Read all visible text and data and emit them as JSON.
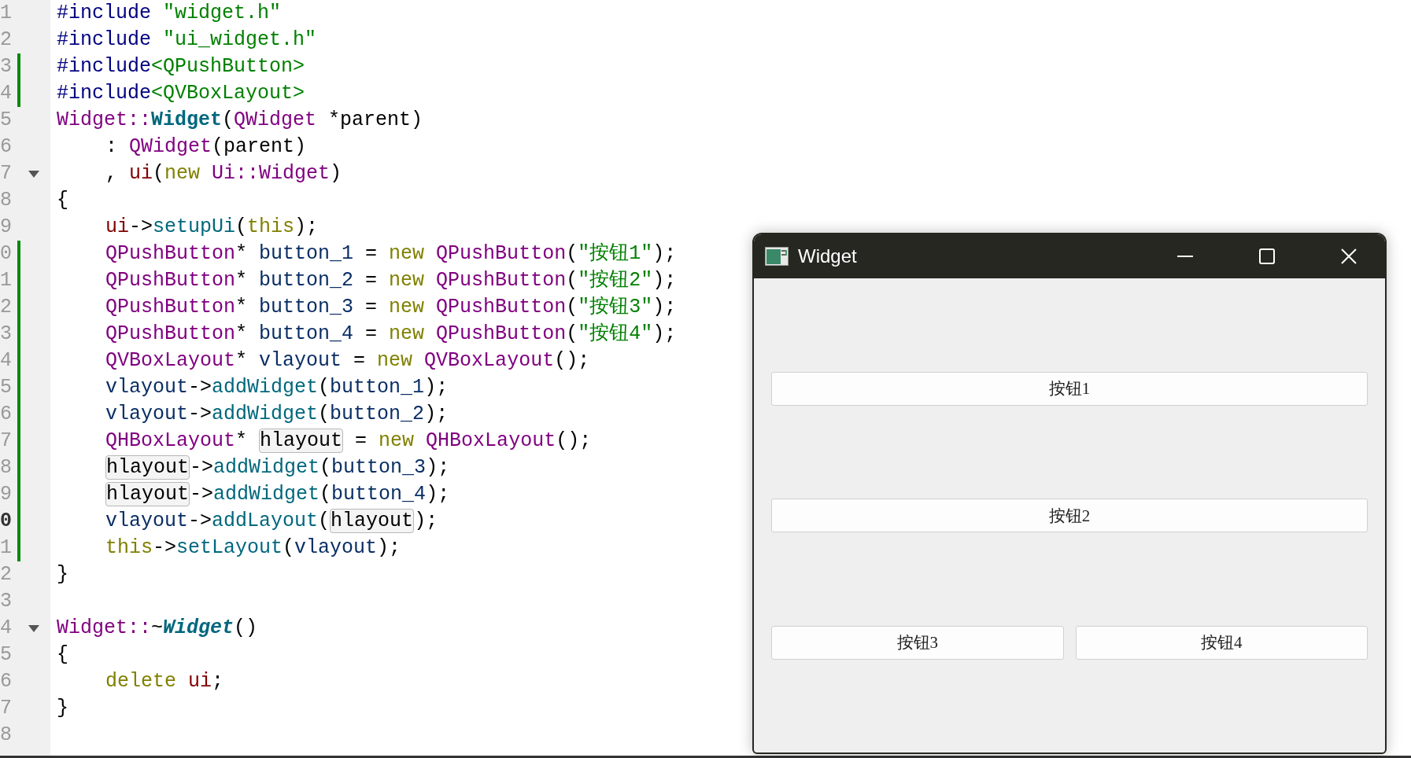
{
  "editor": {
    "lines": [
      {
        "number": "1",
        "changed": false,
        "current": false,
        "foldable": false,
        "indented": false,
        "tokens": [
          {
            "text": "#include ",
            "kind": "macro"
          },
          {
            "text": "\"widget.h\"",
            "kind": "str"
          }
        ]
      },
      {
        "number": "2",
        "changed": false,
        "current": false,
        "foldable": false,
        "indented": false,
        "tokens": [
          {
            "text": "#include ",
            "kind": "macro"
          },
          {
            "text": "\"ui_widget.h\"",
            "kind": "str"
          }
        ]
      },
      {
        "number": "3",
        "changed": true,
        "current": false,
        "foldable": false,
        "indented": false,
        "tokens": [
          {
            "text": "#include",
            "kind": "macro"
          },
          {
            "text": "<QPushButton>",
            "kind": "str"
          }
        ]
      },
      {
        "number": "4",
        "changed": true,
        "current": false,
        "foldable": false,
        "indented": false,
        "tokens": [
          {
            "text": "#include",
            "kind": "macro"
          },
          {
            "text": "<QVBoxLayout>",
            "kind": "str"
          }
        ]
      },
      {
        "number": "5",
        "changed": false,
        "current": false,
        "foldable": false,
        "indented": false,
        "tokens": [
          {
            "text": "Widget::",
            "kind": "type"
          },
          {
            "text": "Widget",
            "kind": "fnb"
          },
          {
            "text": "(",
            "kind": "p"
          },
          {
            "text": "QWidget",
            "kind": "type"
          },
          {
            "text": " *parent)",
            "kind": "p"
          }
        ]
      },
      {
        "number": "6",
        "changed": false,
        "current": false,
        "foldable": false,
        "indented": true,
        "tokens": [
          {
            "text": ": ",
            "kind": "p"
          },
          {
            "text": "QWidget",
            "kind": "type"
          },
          {
            "text": "(parent)",
            "kind": "p"
          }
        ]
      },
      {
        "number": "7",
        "changed": false,
        "current": false,
        "foldable": true,
        "indented": true,
        "tokens": [
          {
            "text": ", ",
            "kind": "p"
          },
          {
            "text": "ui",
            "kind": "mem"
          },
          {
            "text": "(",
            "kind": "p"
          },
          {
            "text": "new ",
            "kind": "kw"
          },
          {
            "text": "Ui::Widget",
            "kind": "type"
          },
          {
            "text": ")",
            "kind": "p"
          }
        ]
      },
      {
        "number": "8",
        "changed": false,
        "current": false,
        "foldable": false,
        "indented": false,
        "tokens": [
          {
            "text": "{",
            "kind": "p"
          }
        ]
      },
      {
        "number": "9",
        "changed": false,
        "current": false,
        "foldable": false,
        "indented": true,
        "tokens": [
          {
            "text": "ui",
            "kind": "mem"
          },
          {
            "text": "->",
            "kind": "p"
          },
          {
            "text": "setupUi",
            "kind": "fn"
          },
          {
            "text": "(",
            "kind": "p"
          },
          {
            "text": "this",
            "kind": "kw"
          },
          {
            "text": ");",
            "kind": "p"
          }
        ]
      },
      {
        "number": "0",
        "changed": true,
        "current": false,
        "foldable": false,
        "indented": true,
        "tokens": [
          {
            "text": "QPushButton",
            "kind": "type"
          },
          {
            "text": "* ",
            "kind": "p"
          },
          {
            "text": "button_1",
            "kind": "var"
          },
          {
            "text": " = ",
            "kind": "p"
          },
          {
            "text": "new ",
            "kind": "kw"
          },
          {
            "text": "QPushButton",
            "kind": "type"
          },
          {
            "text": "(",
            "kind": "p"
          },
          {
            "text": "\"按钮1\"",
            "kind": "str"
          },
          {
            "text": ");",
            "kind": "p"
          }
        ]
      },
      {
        "number": "1",
        "changed": true,
        "current": false,
        "foldable": false,
        "indented": true,
        "tokens": [
          {
            "text": "QPushButton",
            "kind": "type"
          },
          {
            "text": "* ",
            "kind": "p"
          },
          {
            "text": "button_2",
            "kind": "var"
          },
          {
            "text": " = ",
            "kind": "p"
          },
          {
            "text": "new ",
            "kind": "kw"
          },
          {
            "text": "QPushButton",
            "kind": "type"
          },
          {
            "text": "(",
            "kind": "p"
          },
          {
            "text": "\"按钮2\"",
            "kind": "str"
          },
          {
            "text": ");",
            "kind": "p"
          }
        ]
      },
      {
        "number": "2",
        "changed": true,
        "current": false,
        "foldable": false,
        "indented": true,
        "tokens": [
          {
            "text": "QPushButton",
            "kind": "type"
          },
          {
            "text": "* ",
            "kind": "p"
          },
          {
            "text": "button_3",
            "kind": "var"
          },
          {
            "text": " = ",
            "kind": "p"
          },
          {
            "text": "new ",
            "kind": "kw"
          },
          {
            "text": "QPushButton",
            "kind": "type"
          },
          {
            "text": "(",
            "kind": "p"
          },
          {
            "text": "\"按钮3\"",
            "kind": "str"
          },
          {
            "text": ");",
            "kind": "p"
          }
        ]
      },
      {
        "number": "3",
        "changed": true,
        "current": false,
        "foldable": false,
        "indented": true,
        "tokens": [
          {
            "text": "QPushButton",
            "kind": "type"
          },
          {
            "text": "* ",
            "kind": "p"
          },
          {
            "text": "button_4",
            "kind": "var"
          },
          {
            "text": " = ",
            "kind": "p"
          },
          {
            "text": "new ",
            "kind": "kw"
          },
          {
            "text": "QPushButton",
            "kind": "type"
          },
          {
            "text": "(",
            "kind": "p"
          },
          {
            "text": "\"按钮4\"",
            "kind": "str"
          },
          {
            "text": ");",
            "kind": "p"
          }
        ]
      },
      {
        "number": "4",
        "changed": true,
        "current": false,
        "foldable": false,
        "indented": true,
        "tokens": [
          {
            "text": "QVBoxLayout",
            "kind": "type"
          },
          {
            "text": "* ",
            "kind": "p"
          },
          {
            "text": "vlayout",
            "kind": "var"
          },
          {
            "text": " = ",
            "kind": "p"
          },
          {
            "text": "new ",
            "kind": "kw"
          },
          {
            "text": "QVBoxLayout",
            "kind": "type"
          },
          {
            "text": "();",
            "kind": "p"
          }
        ]
      },
      {
        "number": "5",
        "changed": true,
        "current": false,
        "foldable": false,
        "indented": true,
        "tokens": [
          {
            "text": "vlayout",
            "kind": "var"
          },
          {
            "text": "->",
            "kind": "p"
          },
          {
            "text": "addWidget",
            "kind": "fn"
          },
          {
            "text": "(",
            "kind": "p"
          },
          {
            "text": "button_1",
            "kind": "var"
          },
          {
            "text": ");",
            "kind": "p"
          }
        ]
      },
      {
        "number": "6",
        "changed": true,
        "current": false,
        "foldable": false,
        "indented": true,
        "tokens": [
          {
            "text": "vlayout",
            "kind": "var"
          },
          {
            "text": "->",
            "kind": "p"
          },
          {
            "text": "addWidget",
            "kind": "fn"
          },
          {
            "text": "(",
            "kind": "p"
          },
          {
            "text": "button_2",
            "kind": "var"
          },
          {
            "text": ");",
            "kind": "p"
          }
        ]
      },
      {
        "number": "7",
        "changed": true,
        "current": false,
        "foldable": false,
        "indented": true,
        "tokens": [
          {
            "text": "QHBoxLayout",
            "kind": "type"
          },
          {
            "text": "* ",
            "kind": "p"
          },
          {
            "text": "hlayout",
            "kind": "occ"
          },
          {
            "text": " = ",
            "kind": "p"
          },
          {
            "text": "new ",
            "kind": "kw"
          },
          {
            "text": "QHBoxLayout",
            "kind": "type"
          },
          {
            "text": "();",
            "kind": "p"
          }
        ]
      },
      {
        "number": "8",
        "changed": true,
        "current": false,
        "foldable": false,
        "indented": true,
        "tokens": [
          {
            "text": "hlayout",
            "kind": "occ"
          },
          {
            "text": "->",
            "kind": "p"
          },
          {
            "text": "addWidget",
            "kind": "fn"
          },
          {
            "text": "(",
            "kind": "p"
          },
          {
            "text": "button_3",
            "kind": "var"
          },
          {
            "text": ");",
            "kind": "p"
          }
        ]
      },
      {
        "number": "9",
        "changed": true,
        "current": false,
        "foldable": false,
        "indented": true,
        "tokens": [
          {
            "text": "hlayout",
            "kind": "occ"
          },
          {
            "text": "->",
            "kind": "p"
          },
          {
            "text": "addWidget",
            "kind": "fn"
          },
          {
            "text": "(",
            "kind": "p"
          },
          {
            "text": "button_4",
            "kind": "var"
          },
          {
            "text": ");",
            "kind": "p"
          }
        ]
      },
      {
        "number": "0",
        "changed": true,
        "current": true,
        "foldable": false,
        "indented": true,
        "tokens": [
          {
            "text": "vlayout",
            "kind": "var"
          },
          {
            "text": "->",
            "kind": "p"
          },
          {
            "text": "addLayout",
            "kind": "fn"
          },
          {
            "text": "(",
            "kind": "p"
          },
          {
            "text": "hlayout",
            "kind": "occ"
          },
          {
            "text": ");",
            "kind": "p"
          }
        ]
      },
      {
        "number": "1",
        "changed": true,
        "current": false,
        "foldable": false,
        "indented": true,
        "tokens": [
          {
            "text": "this",
            "kind": "kw"
          },
          {
            "text": "->",
            "kind": "p"
          },
          {
            "text": "setLayout",
            "kind": "fn"
          },
          {
            "text": "(",
            "kind": "p"
          },
          {
            "text": "vlayout",
            "kind": "var"
          },
          {
            "text": ");",
            "kind": "p"
          }
        ]
      },
      {
        "number": "2",
        "changed": false,
        "current": false,
        "foldable": false,
        "indented": false,
        "tokens": [
          {
            "text": "}",
            "kind": "p"
          }
        ]
      },
      {
        "number": "3",
        "changed": false,
        "current": false,
        "foldable": false
      },
      {
        "number": "4",
        "changed": false,
        "current": false,
        "foldable": true,
        "indented": false,
        "tokens": [
          {
            "text": "Widget::",
            "kind": "type"
          },
          {
            "text": "~",
            "kind": "p"
          },
          {
            "text": "Widget",
            "kind": "fni"
          },
          {
            "text": "()",
            "kind": "p"
          }
        ]
      },
      {
        "number": "5",
        "changed": false,
        "current": false,
        "foldable": false,
        "indented": false,
        "tokens": [
          {
            "text": "{",
            "kind": "p"
          }
        ]
      },
      {
        "number": "6",
        "changed": false,
        "current": false,
        "foldable": false,
        "indented": true,
        "tokens": [
          {
            "text": "delete ",
            "kind": "kw"
          },
          {
            "text": "ui",
            "kind": "mem"
          },
          {
            "text": ";",
            "kind": "p"
          }
        ]
      },
      {
        "number": "7",
        "changed": false,
        "current": false,
        "foldable": false,
        "indented": false,
        "tokens": [
          {
            "text": "}",
            "kind": "p"
          }
        ]
      },
      {
        "number": "8",
        "changed": false,
        "current": false,
        "foldable": false
      }
    ]
  },
  "window": {
    "title": "Widget",
    "button_rows": [
      {
        "buttons": [
          {
            "label": "按钮1"
          }
        ]
      },
      {
        "buttons": [
          {
            "label": "按钮2"
          }
        ]
      },
      {
        "buttons": [
          {
            "label": "按钮3"
          },
          {
            "label": "按钮4"
          }
        ]
      }
    ]
  }
}
